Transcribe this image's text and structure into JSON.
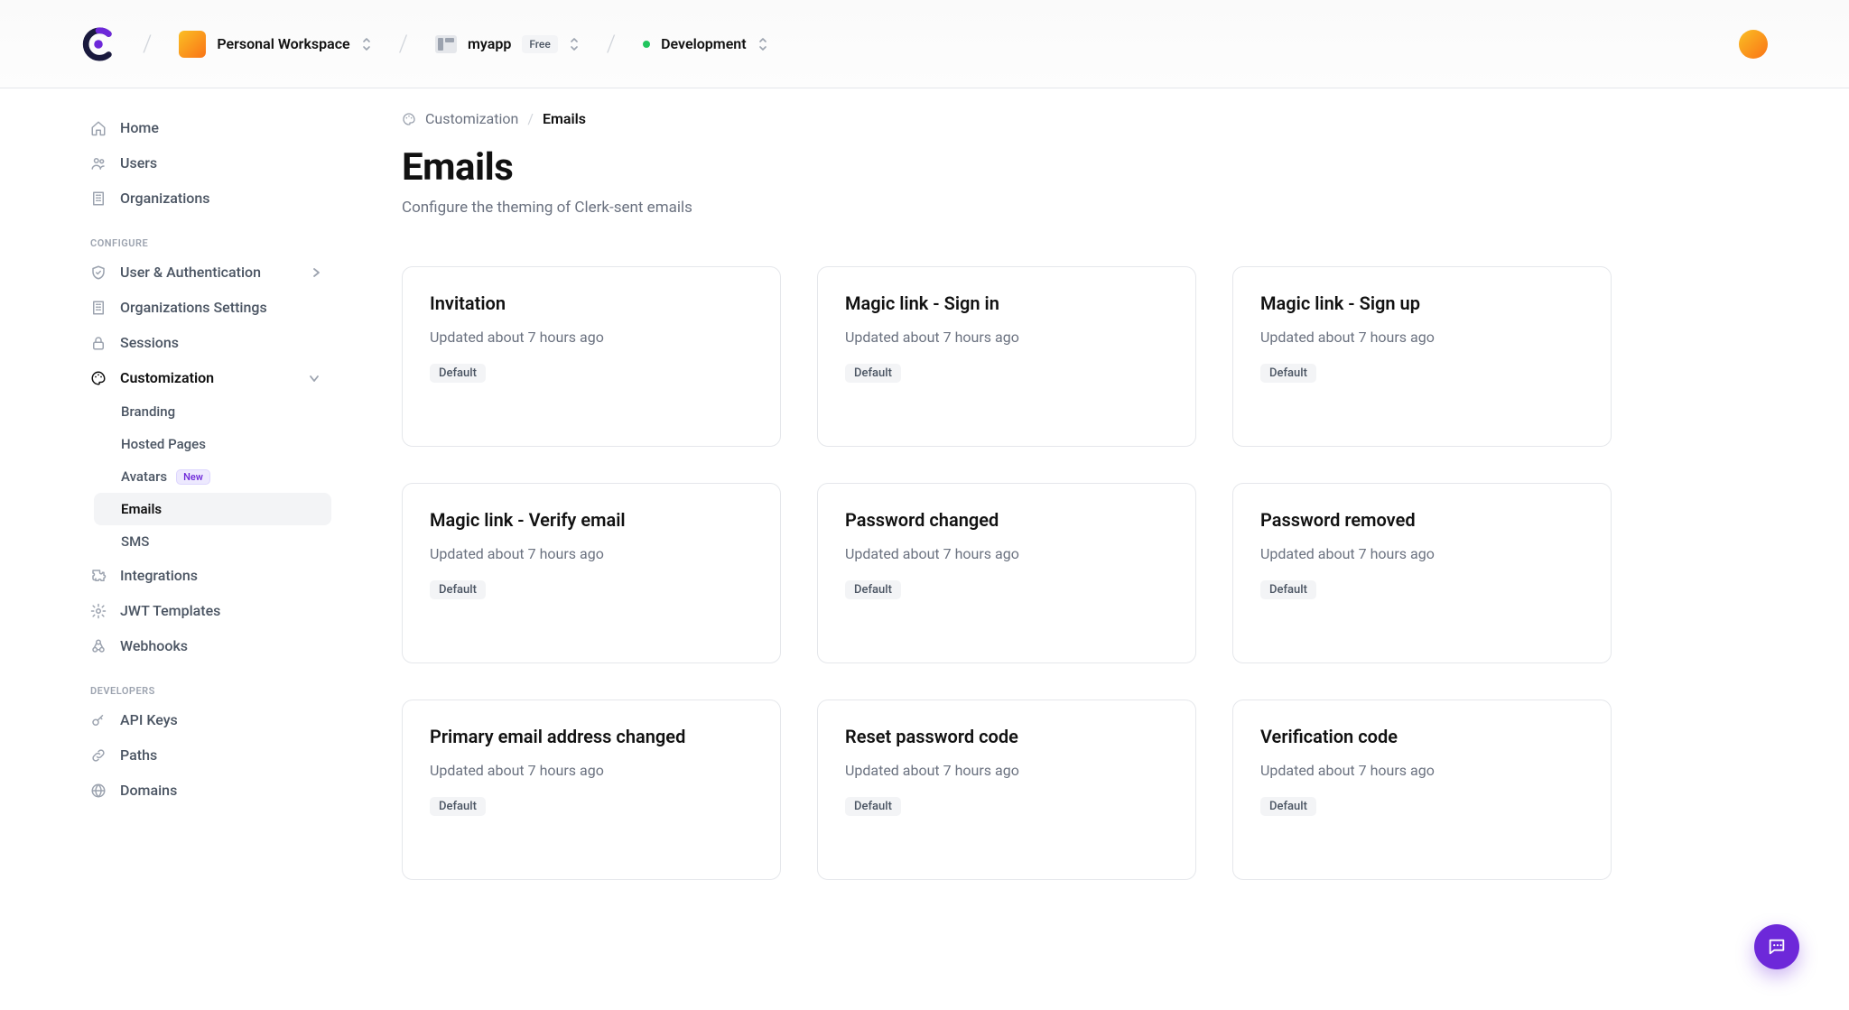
{
  "header": {
    "workspace_name": "Personal Workspace",
    "app_name": "myapp",
    "app_tier": "Free",
    "environment": "Development"
  },
  "sidebar": {
    "main": [
      {
        "label": "Home",
        "icon": "home-icon"
      },
      {
        "label": "Users",
        "icon": "users-icon"
      },
      {
        "label": "Organizations",
        "icon": "org-icon"
      }
    ],
    "configure_label": "CONFIGURE",
    "configure": [
      {
        "label": "User & Authentication",
        "icon": "shield-icon",
        "chevron": true
      },
      {
        "label": "Organizations Settings",
        "icon": "org-icon"
      },
      {
        "label": "Sessions",
        "icon": "lock-icon"
      },
      {
        "label": "Customization",
        "icon": "palette-icon",
        "expanded": true,
        "active_parent": true
      }
    ],
    "customization_sub": [
      {
        "label": "Branding"
      },
      {
        "label": "Hosted Pages"
      },
      {
        "label": "Avatars",
        "badge": "New"
      },
      {
        "label": "Emails",
        "active": true
      },
      {
        "label": "SMS"
      }
    ],
    "configure_tail": [
      {
        "label": "Integrations",
        "icon": "puzzle-icon"
      },
      {
        "label": "JWT Templates",
        "icon": "cog-icon"
      },
      {
        "label": "Webhooks",
        "icon": "webhook-icon"
      }
    ],
    "developers_label": "DEVELOPERS",
    "developers": [
      {
        "label": "API Keys",
        "icon": "key-icon"
      },
      {
        "label": "Paths",
        "icon": "link-icon"
      },
      {
        "label": "Domains",
        "icon": "globe-icon"
      }
    ]
  },
  "breadcrumb": {
    "parent": "Customization",
    "current": "Emails"
  },
  "page": {
    "title": "Emails",
    "subtitle": "Configure the theming of Clerk-sent emails"
  },
  "emails": [
    {
      "title": "Invitation",
      "updated": "Updated about 7 hours ago",
      "status": "Default"
    },
    {
      "title": "Magic link - Sign in",
      "updated": "Updated about 7 hours ago",
      "status": "Default"
    },
    {
      "title": "Magic link - Sign up",
      "updated": "Updated about 7 hours ago",
      "status": "Default"
    },
    {
      "title": "Magic link - Verify email",
      "updated": "Updated about 7 hours ago",
      "status": "Default"
    },
    {
      "title": "Password changed",
      "updated": "Updated about 7 hours ago",
      "status": "Default"
    },
    {
      "title": "Password removed",
      "updated": "Updated about 7 hours ago",
      "status": "Default"
    },
    {
      "title": "Primary email address changed",
      "updated": "Updated about 7 hours ago",
      "status": "Default"
    },
    {
      "title": "Reset password code",
      "updated": "Updated about 7 hours ago",
      "status": "Default"
    },
    {
      "title": "Verification code",
      "updated": "Updated about 7 hours ago",
      "status": "Default"
    }
  ]
}
